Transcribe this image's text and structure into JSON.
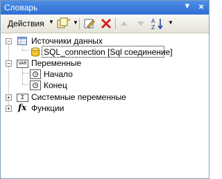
{
  "window": {
    "title": "Словарь",
    "pin_glyph": "▼",
    "close_glyph": "×"
  },
  "toolbar": {
    "actions_label": "Действия",
    "dropdown_glyph": "▼",
    "buttons": [
      {
        "name": "new-item-icon"
      },
      {
        "name": "edit-icon"
      },
      {
        "name": "delete-icon"
      },
      {
        "name": "move-up-icon"
      },
      {
        "name": "move-down-icon"
      },
      {
        "name": "sort-az-icon"
      }
    ]
  },
  "tree": {
    "nodes": [
      {
        "label": "Источники данных",
        "icon": "datasource-icon",
        "expanded": true
      },
      {
        "label": "SQL_connection [Sql соединение]",
        "icon": "database-icon",
        "selected": true
      },
      {
        "label": "Переменные",
        "icon": "variables-icon",
        "expanded": true
      },
      {
        "label": "Начало",
        "icon": "variable-icon"
      },
      {
        "label": "Конец",
        "icon": "variable-icon"
      },
      {
        "label": "Системные переменные",
        "icon": "system-variables-icon",
        "expanded": false
      },
      {
        "label": "Функции",
        "icon": "functions-icon",
        "expanded": false
      }
    ],
    "expand_plus": "+",
    "expand_minus": "−",
    "var_badge": "VAR",
    "sys_badge": "Σ",
    "fx_badge": "fx"
  },
  "colors": {
    "title_bar": "#3a7be0",
    "selection_border": "#000000"
  }
}
